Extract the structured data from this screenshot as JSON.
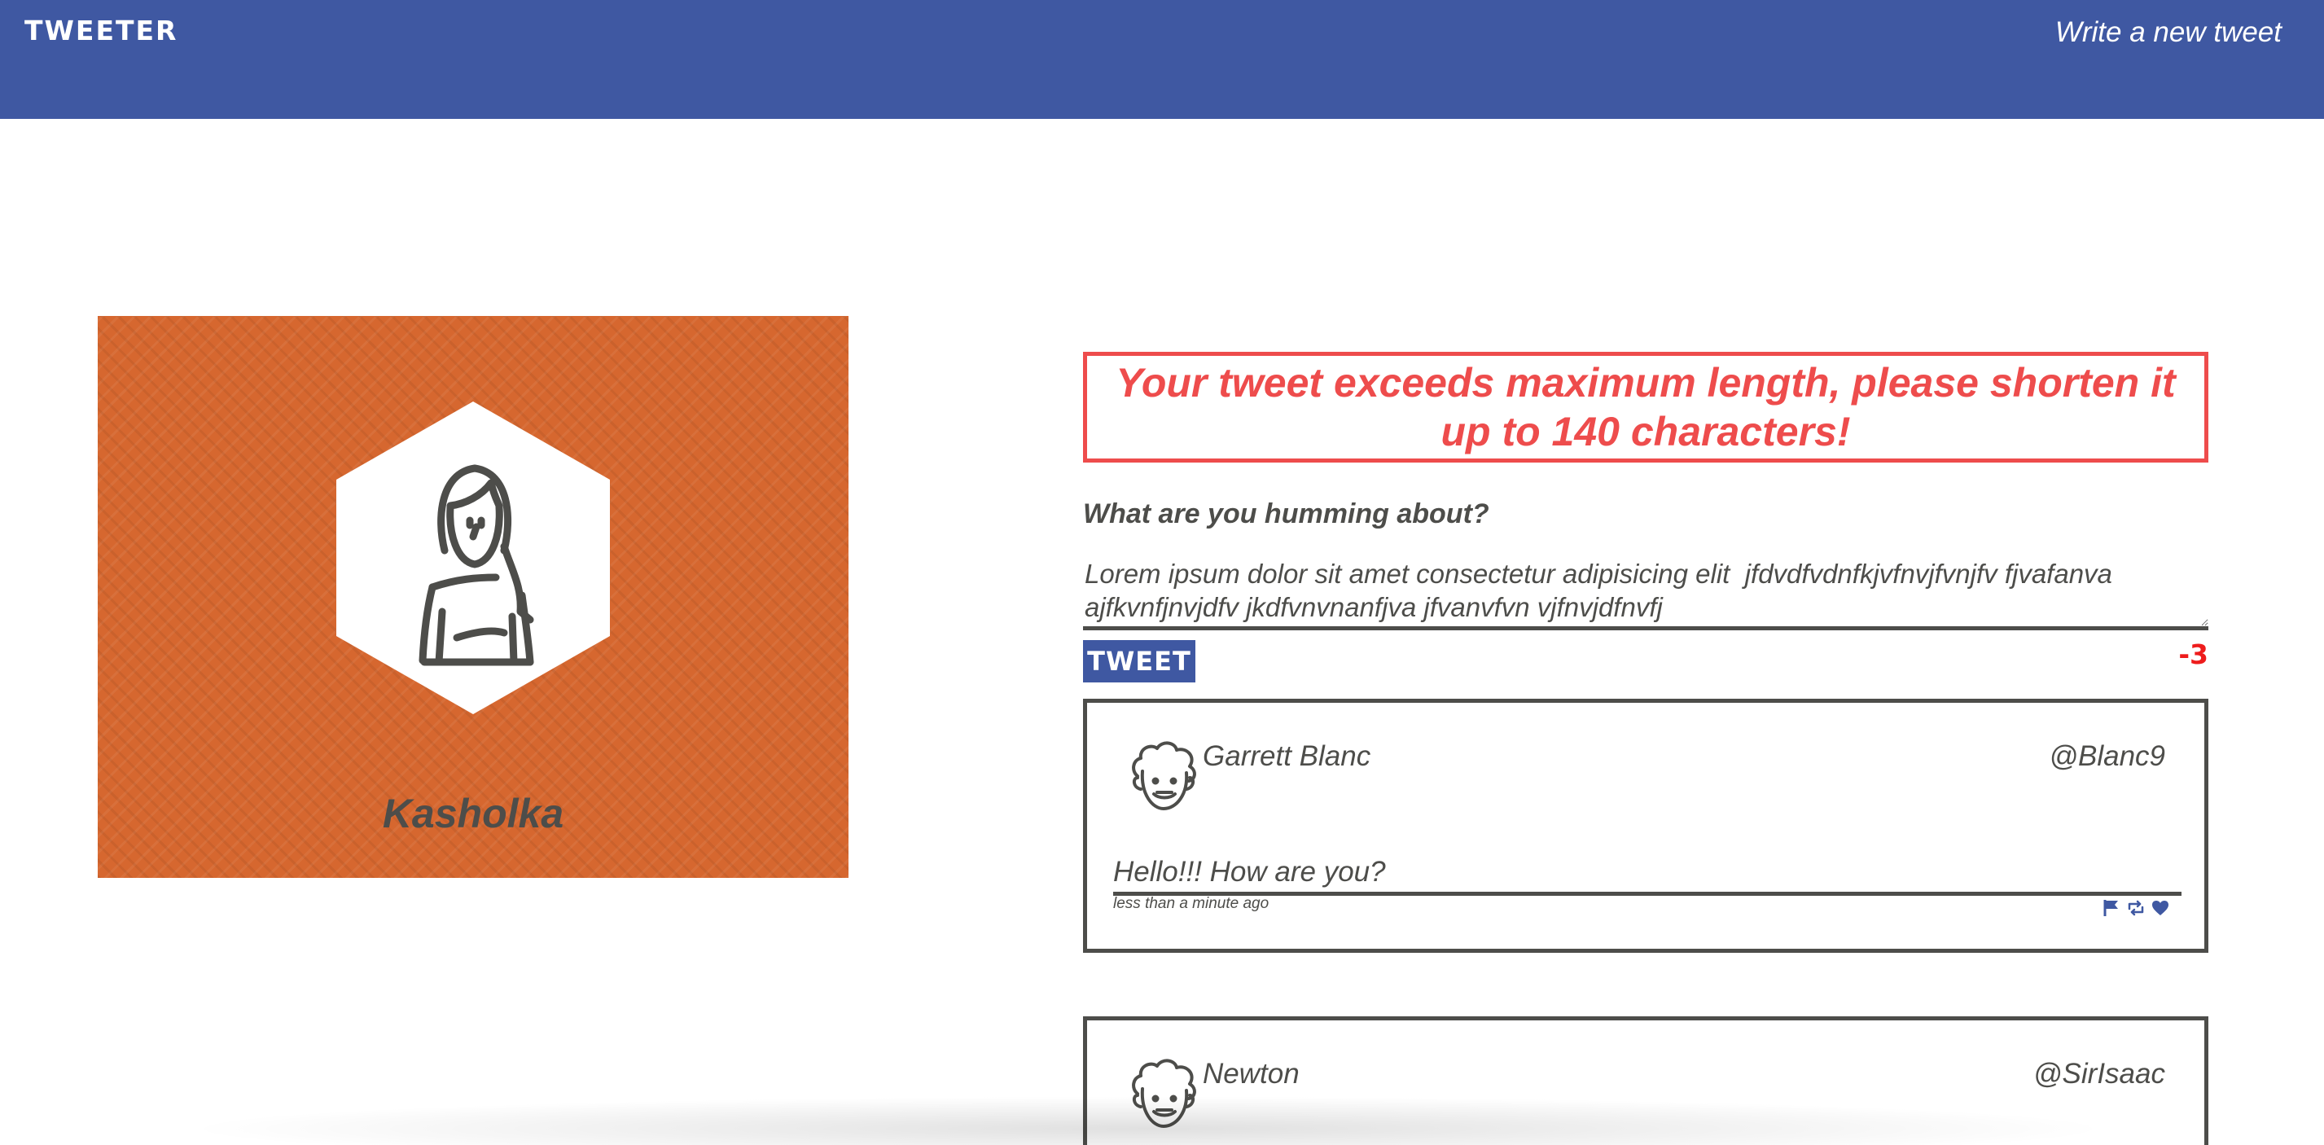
{
  "nav": {
    "brand": "TWEETER",
    "compose_link": "Write a new tweet"
  },
  "profile": {
    "name": "Kasholka"
  },
  "compose": {
    "error": "Your tweet exceeds maximum length, please shorten it up to 140 characters!",
    "label": "What are you humming about?",
    "text": "Lorem ipsum dolor sit amet consectetur adipisicing elit  jfdvdfvdnfkjvfnvjfvnjfv fjvafanva ajfkvnfjnvjdfv jkdfvnvnanfjva jfvanvfvn vjfnvjdfnvfj",
    "button_label": "TWEET",
    "counter": "-3"
  },
  "tweets": [
    {
      "name": "Garrett Blanc",
      "handle": "@Blanc9",
      "content": "Hello!!! How are you?",
      "time": "less than a minute ago",
      "actions": [
        "flag-icon",
        "retweet-icon",
        "heart-icon"
      ]
    },
    {
      "name": "Newton",
      "handle": "@SirIsaac"
    }
  ],
  "colors": {
    "nav": "#3f58a2",
    "profile_bg": "#d6672f",
    "error": "#ee4c4c",
    "counter": "#ee1c1c",
    "text": "#4d4d4a"
  }
}
